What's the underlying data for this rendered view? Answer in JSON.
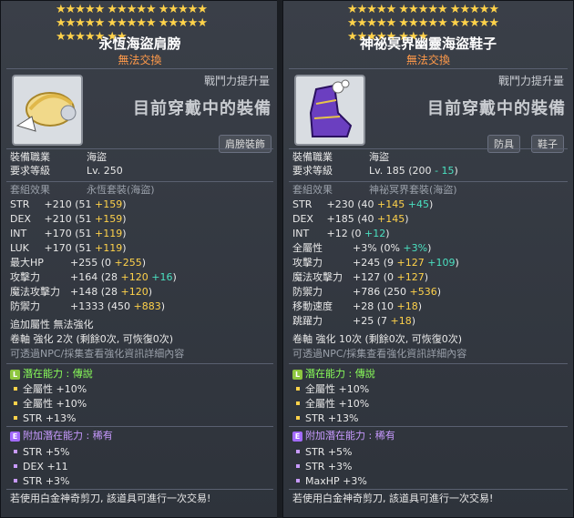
{
  "left": {
    "stars": [
      "★★★★★ ★★★★★ ★★★★★",
      "★★★★★ ★★★★★ ★★★★★",
      "★★★★★ ★★"
    ],
    "title": "永恆海盜肩膀",
    "subtitle": "無法交換",
    "power_label": "戰鬥力提升量",
    "equipped": "目前穿戴中的裝備",
    "tags": [
      "肩膀裝飾"
    ],
    "job_label": "裝備職業",
    "job_value": "海盜",
    "level_label": "要求等級",
    "level_value": "Lv. 250",
    "set_label": "套組效果",
    "set_value": "永恆套裝(海盜)",
    "stats": [
      {
        "k": "STR",
        "base": "+210",
        "a": "(51 ",
        "b": "+159",
        "c": ")"
      },
      {
        "k": "DEX",
        "base": "+210",
        "a": "(51 ",
        "b": "+159",
        "c": ")"
      },
      {
        "k": "INT",
        "base": "+170",
        "a": "(51 ",
        "b": "+119",
        "c": ")"
      },
      {
        "k": "LUK",
        "base": "+170",
        "a": "(51 ",
        "b": "+119",
        "c": ")"
      },
      {
        "k": "最大HP",
        "base": "+255",
        "a": "(0 ",
        "b": "+255",
        "c": ")"
      },
      {
        "k": "攻擊力",
        "base": "+164",
        "a": "(28 ",
        "b": "+120",
        "b2": " +16",
        "c": ")"
      },
      {
        "k": "魔法攻擊力",
        "base": "+148",
        "a": "(28 ",
        "b": "+120",
        "c": ")"
      },
      {
        "k": "防禦力",
        "base": "+1333",
        "a": "(450 ",
        "b": "+883",
        "c": ")"
      }
    ],
    "extra_attr": "追加屬性 無法強化",
    "scroll": "卷軸 強化 2次 (剩餘0次, 可恢復0次)",
    "npc_note": "可透過NPC/採集查看強化資訊詳細內容",
    "potential_label": "潛在能力 : 傳說",
    "potentials": [
      "全屬性 +10%",
      "全屬性 +10%",
      "STR +13%"
    ],
    "bonus_label": "附加潛在能力 : 稀有",
    "bonus": [
      "STR +5%",
      "DEX +11",
      "STR +3%"
    ],
    "footer": "若使用白金神奇剪刀, 該道具可進行一次交易!"
  },
  "right": {
    "stars": [
      "★★★★★ ★★★★★ ★★★★★",
      "★★★★★ ★★★★★ ★★★★★",
      "★★★★★ ★★★"
    ],
    "title": "神祕冥界幽靈海盜鞋子",
    "subtitle": "無法交換",
    "power_label": "戰鬥力提升量",
    "equipped": "目前穿戴中的裝備",
    "tags": [
      "防具",
      "鞋子"
    ],
    "job_label": "裝備職業",
    "job_value": "海盜",
    "level_label": "要求等級",
    "level_value": "Lv. 185 (200 ",
    "level_value2": "- 15",
    "level_value3": ")",
    "set_label": "套組效果",
    "set_value": "神祕冥界套裝(海盜)",
    "stats": [
      {
        "k": "STR",
        "base": "+230",
        "a": "(40 ",
        "b": "+145",
        "b2": " +45",
        "c": ")"
      },
      {
        "k": "DEX",
        "base": "+185",
        "a": "(40 ",
        "b": "+145",
        "c": ")"
      },
      {
        "k": "INT",
        "base": "+12",
        "a": "(0 ",
        "b": "+12",
        "c": ")"
      },
      {
        "k": "全屬性",
        "base": "+3%",
        "a": "(0% ",
        "b": "+3%",
        "c": ")"
      },
      {
        "k": "攻擊力",
        "base": "+245",
        "a": "(9 ",
        "b": "+127",
        "b2": " +109",
        "c": ")"
      },
      {
        "k": "魔法攻擊力",
        "base": "+127",
        "a": "(0 ",
        "b": "+127",
        "c": ")"
      },
      {
        "k": "防禦力",
        "base": "+786",
        "a": "(250 ",
        "b": "+536",
        "c": ")"
      },
      {
        "k": "移動速度",
        "base": "+28",
        "a": "(10 ",
        "b": "+18",
        "c": ")"
      },
      {
        "k": "跳躍力",
        "base": "+25",
        "a": "(7 ",
        "b": "+18",
        "c": ")"
      }
    ],
    "scroll": "卷軸 強化 10次 (剩餘0次, 可恢復0次)",
    "npc_note": "可透過NPC/採集查看強化資訊詳細內容",
    "potential_label": "潛在能力 : 傳說",
    "potentials": [
      "全屬性 +10%",
      "全屬性 +10%",
      "STR +13%"
    ],
    "bonus_label": "附加潛在能力 : 稀有",
    "bonus": [
      "STR +5%",
      "STR +3%",
      "MaxHP +3%"
    ],
    "footer": "若使用白金神奇剪刀, 該道具可進行一次交易!"
  }
}
